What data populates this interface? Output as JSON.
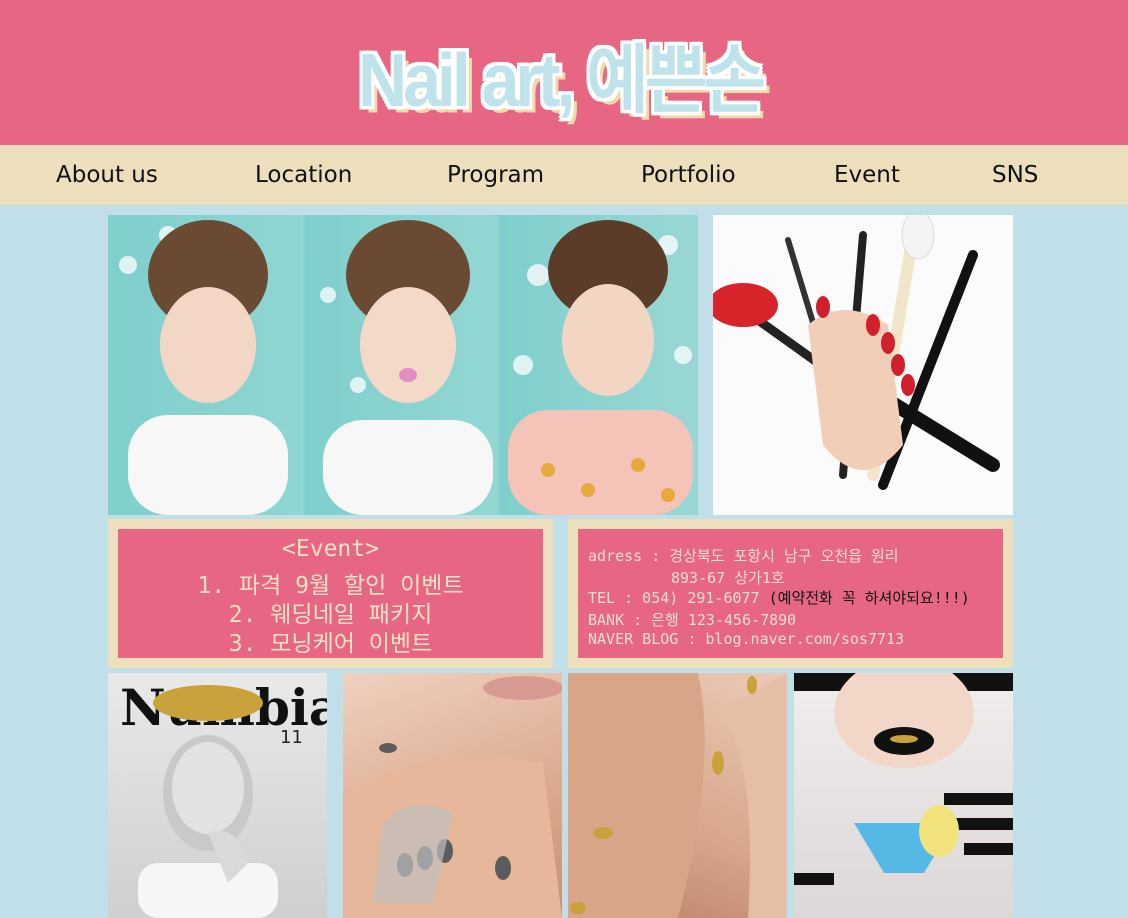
{
  "header": {
    "logo_text": "Nail art, 예쁜손"
  },
  "nav": {
    "items": [
      "About us",
      "Location",
      "Program",
      "Portfolio",
      "Event",
      "SNS"
    ]
  },
  "event": {
    "title": "<Event>",
    "items": [
      "1. 파격 9월 할인 이벤트",
      "2. 웨딩네일 패키지",
      "3. 모닝케어 이벤트"
    ]
  },
  "info": {
    "address_line1": "adress : 경상북도 포항시 남구 오천읍 원리",
    "address_line2": "893-67 상가1호",
    "tel": "TEL : 054) 291-6077",
    "tel_note": "(예약전화 꼭 하셔야되요!!!)",
    "bank": "BANK : 은행 123-456-7890",
    "blog": "NAVER BLOG : blog.naver.com/sos7713"
  },
  "photos": {
    "magazine_title": "Numbia",
    "magazine_issue": "11"
  },
  "colors": {
    "background": "#c1dfe8",
    "header": "#e76683",
    "nav": "#eddfbd",
    "text_cream": "#f3e2c6"
  }
}
